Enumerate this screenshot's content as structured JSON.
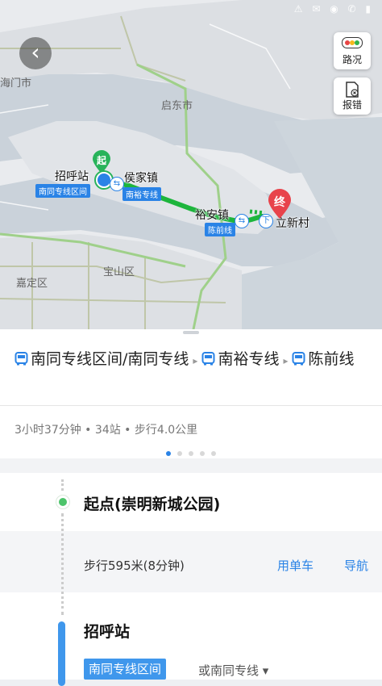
{
  "status": {
    "icons": "⚠ ✉ ◉ ✆ ▮"
  },
  "map": {
    "back_icon": "‹",
    "traffic_label": "路况",
    "report_label": "报错",
    "cities": {
      "haimen": "海门市",
      "qidong": "启东市",
      "baoshan": "宝山区",
      "jiading": "嘉定区"
    },
    "places": {
      "zhaohu": "招呼站",
      "houjia": "侯家镇",
      "yuan": "裕安镇",
      "lixin": "立新村"
    },
    "tags": {
      "nantong_section": "南同专线区间",
      "nanyu": "南裕专线",
      "chenqian": "陈前线"
    },
    "start_marker": "起",
    "end_marker": "终",
    "transfer_marker": "下",
    "colors": {
      "route": "#1db53c",
      "start": "#28b35a",
      "end": "#e8434b",
      "accent": "#2a83e6"
    }
  },
  "route": {
    "segments": [
      "南同专线区间/南同专线",
      "南裕专线",
      "陈前线"
    ],
    "separator": "▸",
    "summary": [
      "3小时37分钟",
      "34站",
      "步行4.0公里"
    ],
    "summary_sep": " • ",
    "pages": 5,
    "active_page": 1
  },
  "steps": {
    "start_title": "起点(崇明新城公园)",
    "walk_text": "步行595米(8分钟)",
    "bike_link": "用单车",
    "nav_link": "导航",
    "stop_title": "招呼站",
    "line_chip": "南同专线区间",
    "alt_line": "或南同专线 ▾"
  }
}
